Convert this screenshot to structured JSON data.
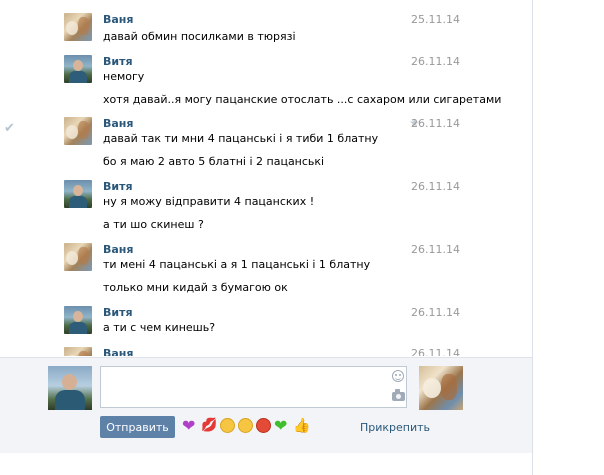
{
  "messages": [
    {
      "sender": "Ваня",
      "date": "25.11.14",
      "lines": [
        "давай обмин посилками в тюрязі"
      ],
      "starred": false,
      "read_mark": false
    },
    {
      "sender": "Витя",
      "date": "26.11.14",
      "lines": [
        "немогу",
        "хотя давай..я могу пацанские отослать ...с сахаром или сигаретами"
      ],
      "starred": false,
      "read_mark": false
    },
    {
      "sender": "Ваня",
      "date": "26.11.14",
      "lines": [
        "давай так ти мни 4 пацанські і я тиби 1 блатну",
        "бо я маю 2 авто 5 блатні і 2 пацанські"
      ],
      "starred": true,
      "read_mark": true
    },
    {
      "sender": "Витя",
      "date": "26.11.14",
      "lines": [
        "ну я можу відправити 4 пацанских !",
        "а ти шо скинеш ?"
      ],
      "starred": false,
      "read_mark": false
    },
    {
      "sender": "Ваня",
      "date": "26.11.14",
      "lines": [
        "ти мені 4 пацанські а я 1 пацанські і 1 блатну",
        "только мни кидай з бумагою ок"
      ],
      "starred": false,
      "read_mark": false
    },
    {
      "sender": "Витя",
      "date": "26.11.14",
      "lines": [
        "а ти с чем кинешь?"
      ],
      "starred": false,
      "read_mark": false
    },
    {
      "sender": "Ваня",
      "date": "26.11.14",
      "lines": [],
      "starred": false,
      "read_mark": false
    }
  ],
  "icons": {
    "read_mark": "✔",
    "star": "★",
    "emoji_row": [
      "purple-heart-icon",
      "lips-icon",
      "laughing-face-icon",
      "sad-face-icon",
      "angry-face-icon",
      "green-heart-icon",
      "thumbs-up-icon"
    ]
  },
  "composer": {
    "input_value": "",
    "send_label": "Отправить",
    "attach_label": "Прикрепить"
  },
  "colors": {
    "name_link": "#2b587a",
    "send_button": "#5e81a8",
    "date": "#999999"
  }
}
